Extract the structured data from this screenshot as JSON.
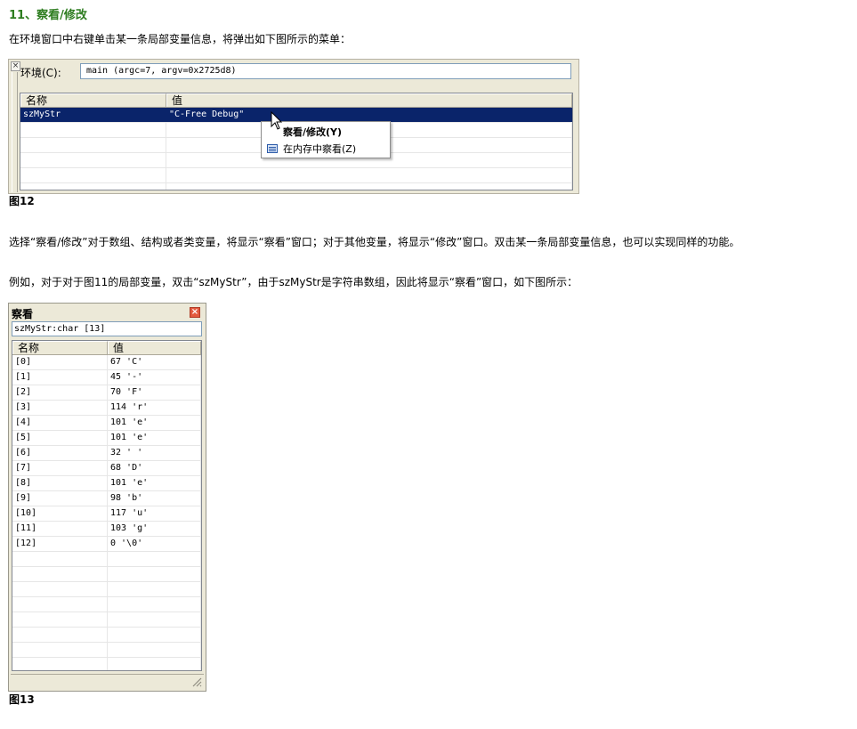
{
  "heading": "11、察看/修改",
  "intro": "在环境窗口中右键单击某一条局部变量信息，将弹出如下图所示的菜单：",
  "fig12": {
    "env_label": "环境(C):",
    "env_value": "main (argc=7, argv=0x2725d8)",
    "columns": [
      "名称",
      "值"
    ],
    "selected_row": {
      "name": "szMyStr",
      "value": "\"C-Free Debug\""
    },
    "empty_rows": 5,
    "caption": "图12",
    "context_menu": {
      "items": [
        {
          "label": "察看/修改(Y)",
          "bold": true,
          "icon": ""
        },
        {
          "label": "在内存中察看(Z)",
          "bold": false,
          "icon": "memory-view-icon"
        }
      ]
    }
  },
  "para2": "选择“察看/修改”对于数组、结构或者类变量，将显示“察看”窗口；对于其他变量，将显示“修改”窗口。双击某一条局部变量信息，也可以实现同样的功能。",
  "para3": "例如，对于对于图11的局部变量，双击“szMyStr”，由于szMyStr是字符串数组，因此将显示“察看”窗口，如下图所示：",
  "fig13": {
    "title": "察看",
    "expression": "szMyStr:char [13]",
    "columns": [
      "名称",
      "值"
    ],
    "rows": [
      {
        "name": "[0]",
        "value": "67 'C'"
      },
      {
        "name": "[1]",
        "value": "45 '-'"
      },
      {
        "name": "[2]",
        "value": "70 'F'"
      },
      {
        "name": "[3]",
        "value": "114 'r'"
      },
      {
        "name": "[4]",
        "value": "101 'e'"
      },
      {
        "name": "[5]",
        "value": "101 'e'"
      },
      {
        "name": "[6]",
        "value": "32 ' '"
      },
      {
        "name": "[7]",
        "value": "68 'D'"
      },
      {
        "name": "[8]",
        "value": "101 'e'"
      },
      {
        "name": "[9]",
        "value": "98 'b'"
      },
      {
        "name": "[10]",
        "value": "117 'u'"
      },
      {
        "name": "[11]",
        "value": "103 'g'"
      },
      {
        "name": "[12]",
        "value": "0 '\\0'"
      }
    ],
    "empty_rows": 8,
    "caption": "图13"
  },
  "colors": {
    "heading": "#2e7d20",
    "selection": "#0a246a",
    "close": "#e35a3e",
    "window_bg": "#ece9d8"
  }
}
